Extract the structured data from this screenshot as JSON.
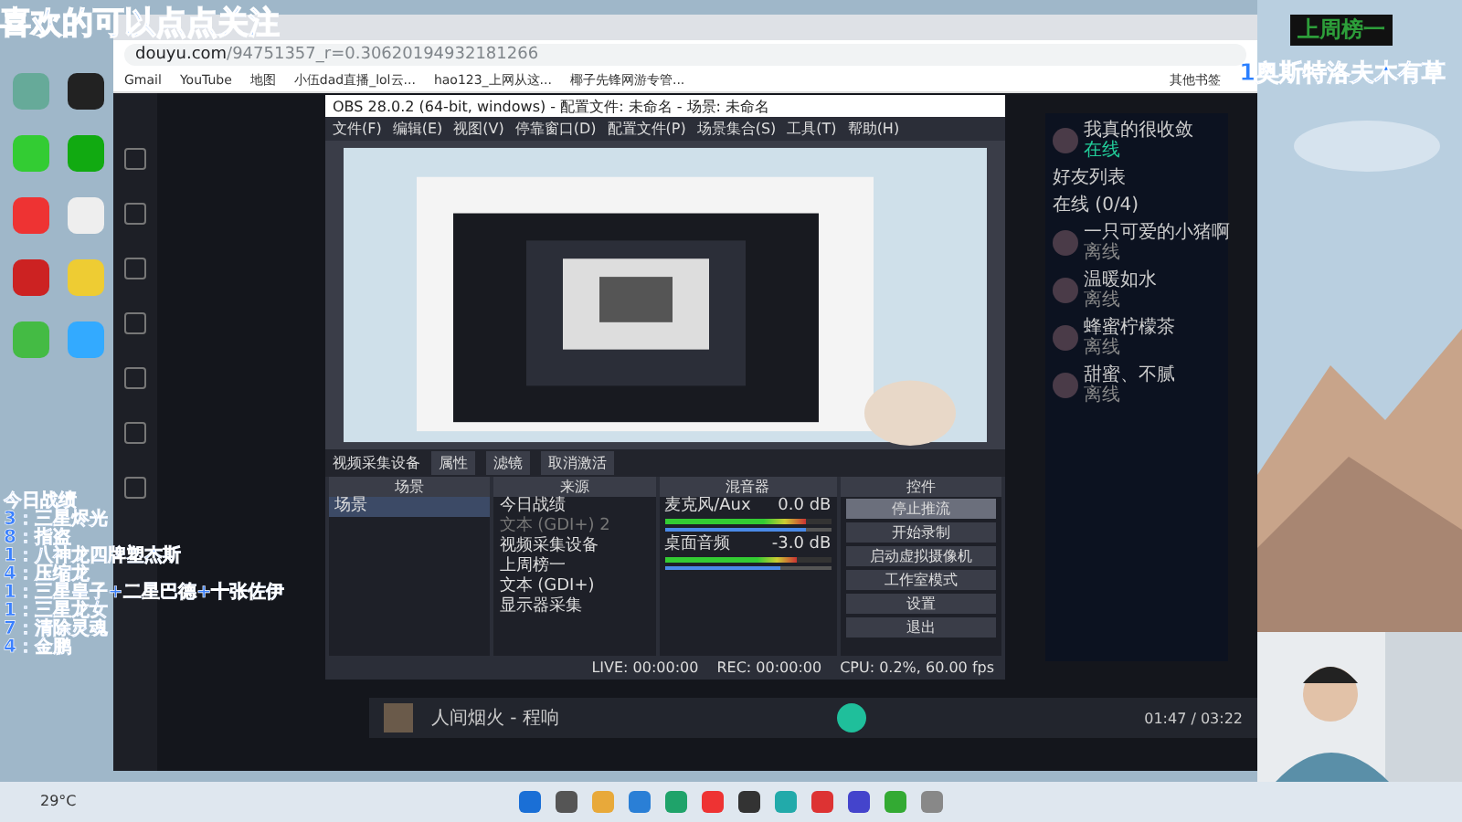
{
  "overlay": {
    "banner": "喜欢的可以点点关注",
    "rank_title": "上周榜一",
    "rank_name": "1奥斯特洛夫木有草",
    "stats": [
      "今日战绩",
      "3：三星烬光",
      "8：指盗",
      "1：八神龙四牌塑杰斯",
      "4：压缩龙",
      "1：三星皇子+二星巴德+十张佐伊",
      "1：三星龙女",
      "7：清除灵魂",
      "4：金鹏"
    ]
  },
  "browser": {
    "url_domain": "douyu.com",
    "url_path": "/94751357_r=0.30620194932181266",
    "bookmarks": [
      "Gmail",
      "YouTube",
      "地图",
      "小伍dad直播_lol云...",
      "hao123_上网从这...",
      "椰子先锋网游专管..."
    ],
    "other_bookmarks": "其他书签"
  },
  "obs": {
    "title": "OBS 28.0.2 (64-bit, windows) - 配置文件: 未命名 - 场景: 未命名",
    "menu": [
      "文件(F)",
      "编辑(E)",
      "视图(V)",
      "停靠窗口(D)",
      "配置文件(P)",
      "场景集合(S)",
      "工具(T)",
      "帮助(H)"
    ],
    "source_label": "视频采集设备",
    "source_buttons": [
      "属性",
      "滤镜",
      "取消激活"
    ],
    "docks": [
      "场景",
      "来源",
      "混音器",
      "控件"
    ],
    "scenes": [
      {
        "name": "场景",
        "selected": true
      }
    ],
    "sources": [
      {
        "name": "今日战绩",
        "visible": true
      },
      {
        "name": "文本 (GDI+) 2",
        "visible": false
      },
      {
        "name": "视频采集设备",
        "visible": true
      },
      {
        "name": "上周榜一",
        "visible": true
      },
      {
        "name": "文本 (GDI+)",
        "visible": true
      },
      {
        "name": "显示器采集",
        "visible": true
      }
    ],
    "mixer": [
      {
        "name": "麦克风/Aux",
        "reading": "0.0 dB",
        "level": 0.85,
        "volume": {
          "level": 0.85
        }
      },
      {
        "name": "桌面音频",
        "reading": "-3.0 dB",
        "level": 0.8,
        "volume": {
          "level": 0.7
        }
      }
    ],
    "controls": [
      {
        "label": "停止推流",
        "selected": true
      },
      {
        "label": "开始录制",
        "selected": false
      },
      {
        "label": "启动虚拟摄像机",
        "selected": false
      },
      {
        "label": "工作室模式",
        "selected": false
      },
      {
        "label": "设置",
        "selected": false
      },
      {
        "label": "退出",
        "selected": false
      }
    ],
    "status": {
      "live": "LIVE: 00:00:00",
      "rec": "REC: 00:00:00",
      "cpu": "CPU: 0.2%, 60.00 fps"
    }
  },
  "friends": {
    "user": "我真的很收敛",
    "status": "在线",
    "header": "好友列表",
    "group": "在线 (0/4)",
    "items": [
      {
        "name": "一只可爱的小猪啊",
        "status": "离线"
      },
      {
        "name": "温暖如水",
        "status": "离线"
      },
      {
        "name": "蜂蜜柠檬茶",
        "status": "离线"
      },
      {
        "name": "甜蜜、不腻",
        "status": "离线"
      }
    ]
  },
  "player": {
    "song": "人间烟火 - 程响",
    "time": "01:47 / 03:22"
  },
  "taskbar": {
    "weather": "29°C"
  }
}
